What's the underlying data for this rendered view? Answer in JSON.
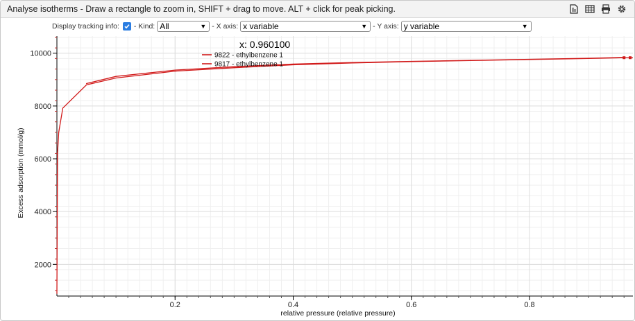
{
  "header": {
    "title": "Analyse isotherms - Draw a rectangle to zoom in, SHIFT + drag to move. ALT + click for peak picking.",
    "icons": [
      "export-svg-icon",
      "table-icon",
      "print-icon",
      "settings-icon"
    ]
  },
  "controls": {
    "tracking_label": "Display tracking info:",
    "tracking_checked": true,
    "kind_label": "- Kind:",
    "kind_value": "All",
    "xaxis_label": "- X axis:",
    "xaxis_value": "x variable",
    "yaxis_label": "- Y axis:",
    "yaxis_value": "y variable"
  },
  "tracking": {
    "text": "x: 0.960100"
  },
  "colors": {
    "series1": "#d11a1a",
    "series2": "#d11a1a",
    "grid_major": "#dcdcdc",
    "grid_minor": "#efefef",
    "axis": "#000000"
  },
  "chart_data": {
    "type": "line",
    "xlabel": "relative pressure  (relative pressure)",
    "ylabel": "Excess adsorption  (mmol/g)",
    "xlim": [
      0,
      0.975
    ],
    "ylim": [
      800,
      10650
    ],
    "xticks": [
      0.2,
      0.4,
      0.6,
      0.8
    ],
    "xtick_labels": [
      "0.2",
      "0.4",
      "0.6",
      "0.8"
    ],
    "yticks": [
      2000,
      4000,
      6000,
      8000,
      10000
    ],
    "ytick_labels": [
      "2000",
      "4000",
      "6000",
      "8000",
      "10000"
    ],
    "grid": true,
    "legend_position": "top-center",
    "series": [
      {
        "name": "9822 - ethylbenzene 1",
        "x": [
          0.0,
          0.001,
          0.003,
          0.01,
          0.05,
          0.1,
          0.2,
          0.3,
          0.4,
          0.5,
          0.6,
          0.7,
          0.8,
          0.9,
          0.96
        ],
        "y": [
          900,
          6200,
          7000,
          7920,
          8800,
          9060,
          9320,
          9450,
          9560,
          9630,
          9680,
          9720,
          9760,
          9800,
          9830
        ]
      },
      {
        "name": "9817 - ethylbenzene 1",
        "x": [
          0.05,
          0.1,
          0.2,
          0.3,
          0.4,
          0.5,
          0.6,
          0.7,
          0.8,
          0.9,
          0.96
        ],
        "y": [
          8850,
          9120,
          9360,
          9490,
          9590,
          9650,
          9690,
          9730,
          9770,
          9810,
          9840
        ]
      }
    ]
  }
}
